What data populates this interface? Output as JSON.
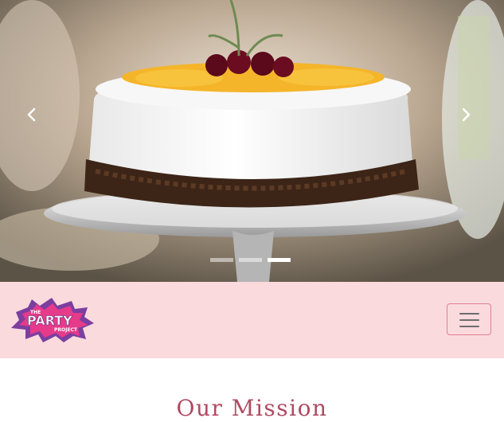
{
  "carousel": {
    "prev_label": "Previous",
    "next_label": "Next",
    "slide_count": 3,
    "active_slide": 2,
    "slide_image": "cake-with-fruit-and-cherries"
  },
  "navbar": {
    "brand": {
      "logo_text_the": "THE",
      "logo_text_party": "PARTY",
      "logo_text_project": "PROJECT"
    },
    "toggler_icon": "hamburger-menu-icon"
  },
  "mission": {
    "title": "Our Mission"
  },
  "colors": {
    "navbar_bg": "#fadadd",
    "accent": "#b04a62",
    "toggler_border": "#e07f95"
  }
}
